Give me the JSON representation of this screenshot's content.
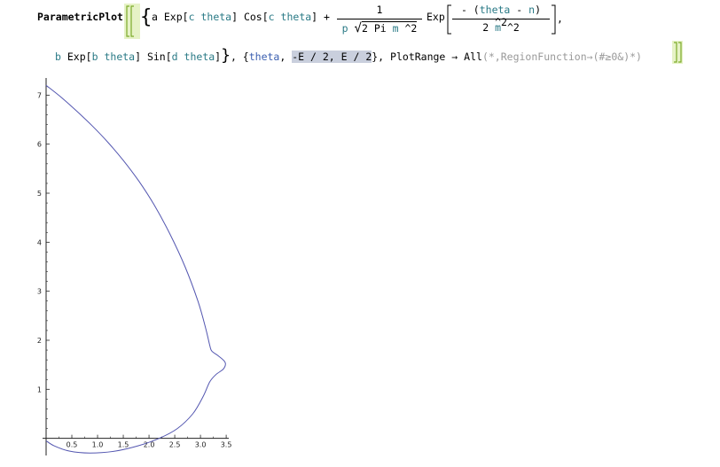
{
  "input": {
    "head": "ParametricPlot",
    "line1": {
      "open": "{",
      "x_expr_a": "a",
      "exp1": "Exp",
      "c1": "c",
      "theta1": "theta",
      "cos": "Cos",
      "c2": "c",
      "theta2": "theta",
      "plus": "+",
      "frac_num": "1",
      "frac_den_p": "p",
      "frac_den_rad": "2 Pi",
      "frac_den_m": "m",
      "frac_den_pow": "^2",
      "exp2": "Exp",
      "frac2_num_minus": "- (",
      "frac2_num_theta": "theta",
      "frac2_num_minus_n": "-",
      "frac2_num_n": "n",
      "frac2_num_close": ") ^2",
      "frac2_den": "2",
      "frac2_den_m": "m",
      "frac2_den_pow": "^2",
      "comma": ","
    },
    "line2": {
      "b1": "b",
      "exp": "Exp",
      "b2": "b",
      "theta1": "theta",
      "sin": "Sin",
      "d": "d",
      "theta2": "theta",
      "close_brace": "}",
      "range_open": ", {",
      "range_var": "theta",
      "range_sep": ",",
      "range_bounds": "-E / 2, E / 2",
      "range_close": "},",
      "option": "PlotRange",
      "arrow": "→",
      "all": "All",
      "comment": "(*,RegionFunction→(#≥0&)*)"
    }
  },
  "chart_data": {
    "type": "line",
    "title": "",
    "xlabel": "",
    "ylabel": "",
    "xlim": [
      0,
      3.55
    ],
    "ylim": [
      -0.35,
      7.35
    ],
    "x_ticks": [
      "0.5",
      "1.0",
      "1.5",
      "2.0",
      "2.5",
      "3.0",
      "3.5"
    ],
    "y_ticks": [
      "1",
      "2",
      "3",
      "4",
      "5",
      "6",
      "7"
    ],
    "line_color": "#5356b0",
    "series": [
      {
        "points": [
          [
            0.0,
            7.2
          ],
          [
            0.3,
            6.95
          ],
          [
            0.6,
            6.67
          ],
          [
            0.9,
            6.37
          ],
          [
            1.2,
            6.04
          ],
          [
            1.5,
            5.67
          ],
          [
            1.8,
            5.25
          ],
          [
            2.1,
            4.76
          ],
          [
            2.4,
            4.18
          ],
          [
            2.7,
            3.5
          ],
          [
            2.95,
            2.8
          ],
          [
            3.1,
            2.25
          ],
          [
            3.18,
            1.9
          ],
          [
            3.22,
            1.78
          ],
          [
            3.35,
            1.68
          ],
          [
            3.48,
            1.55
          ],
          [
            3.45,
            1.42
          ],
          [
            3.3,
            1.3
          ],
          [
            3.18,
            1.15
          ],
          [
            3.05,
            0.85
          ],
          [
            2.85,
            0.5
          ],
          [
            2.55,
            0.2
          ],
          [
            2.2,
            0.0
          ],
          [
            1.8,
            -0.15
          ],
          [
            1.35,
            -0.26
          ],
          [
            0.85,
            -0.3
          ],
          [
            0.45,
            -0.26
          ],
          [
            0.15,
            -0.15
          ],
          [
            0.0,
            -0.05
          ]
        ]
      }
    ]
  }
}
